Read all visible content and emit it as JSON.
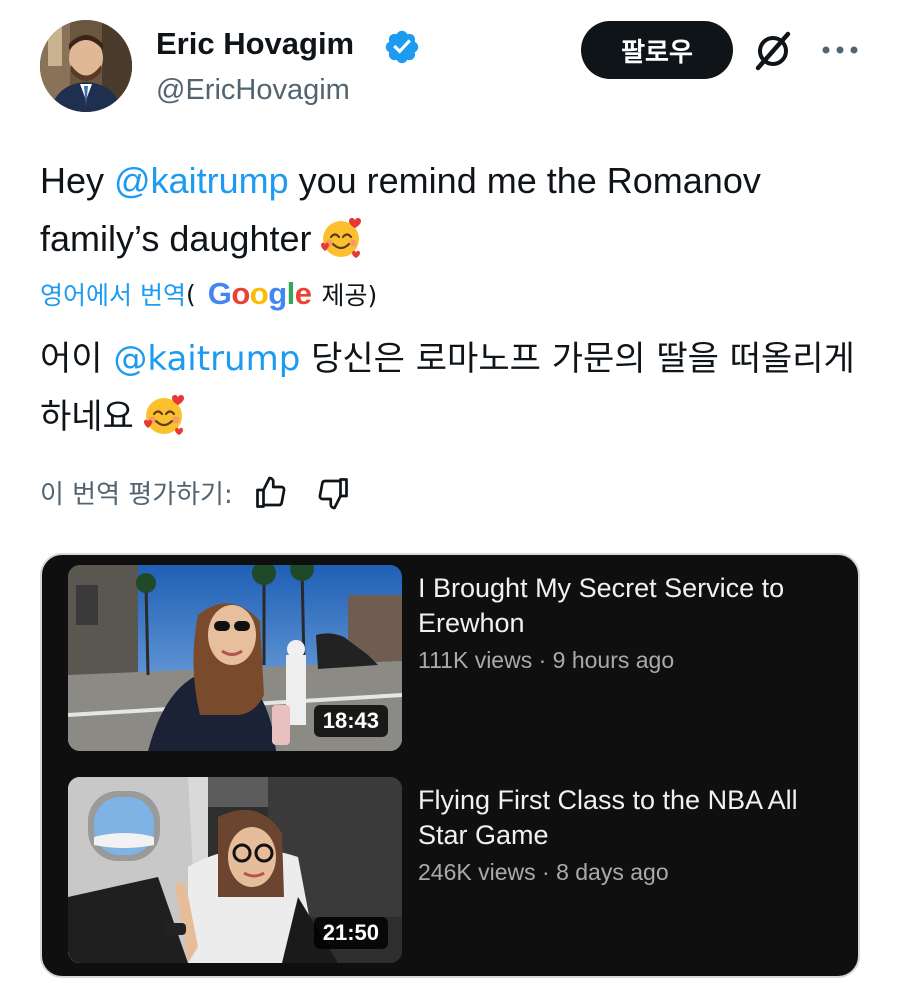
{
  "author": {
    "display_name": "Eric Hovagim",
    "handle": "@EricHovagim",
    "verified_icon": "verified-badge-icon"
  },
  "actions": {
    "follow_label": "팔로우",
    "grok_icon": "grok-icon",
    "more_icon": "more-icon"
  },
  "tweet": {
    "text_before": "Hey ",
    "mention": "@kaitrump",
    "text_after": " you remind me the Romanov family’s daughter",
    "emoji": "smiling-face-with-hearts"
  },
  "translation": {
    "label": "영어에서 번역",
    "paren_open": "(",
    "google": "Google",
    "provided": "제공)",
    "text_before": "어이 ",
    "mention": "@kaitrump",
    "text_after": " 당신은 로마노프 가문의 딸을 떠올리게 하네요"
  },
  "rating": {
    "label": "이 번역 평가하기:",
    "up_icon": "thumbs-up-icon",
    "down_icon": "thumbs-down-icon"
  },
  "videos": [
    {
      "title": "I Brought My Secret Service to Erewhon",
      "views": "111K views",
      "age": "9 hours ago",
      "duration": "18:43"
    },
    {
      "title": "Flying First Class to the NBA All Star Game",
      "views": "246K views",
      "age": "8 days ago",
      "duration": "21:50"
    }
  ],
  "colors": {
    "accent": "#1d9bf0",
    "text": "#0f1419",
    "secondary": "#536471",
    "card_bg": "#0f0f0f"
  }
}
